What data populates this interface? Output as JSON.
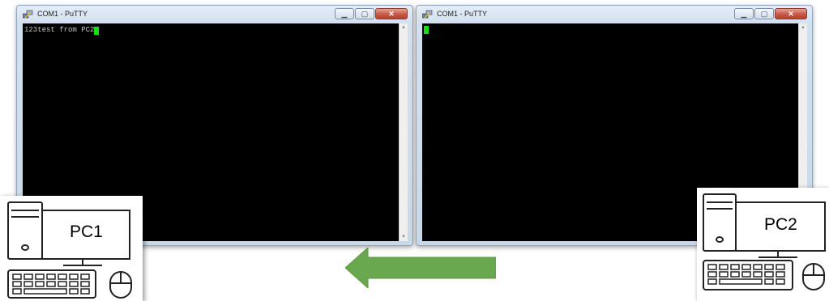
{
  "windows": [
    {
      "title": "COM1 - PuTTY",
      "terminal_text": "123test from PC2",
      "cursor_visible": true,
      "controls": [
        "minimize",
        "maximize",
        "close"
      ]
    },
    {
      "title": "COM1 - PuTTY",
      "terminal_text": "",
      "cursor_visible": true,
      "controls": [
        "minimize",
        "maximize",
        "close"
      ]
    }
  ],
  "pcs": [
    {
      "label": "PC1",
      "icon": "desktop-computer-icon"
    },
    {
      "label": "PC2",
      "icon": "desktop-computer-icon"
    }
  ],
  "arrow": {
    "direction": "left",
    "color": "#6aa84f"
  },
  "colors": {
    "terminal_bg": "#000000",
    "cursor": "#14e014",
    "close_button": "#c85a45"
  }
}
